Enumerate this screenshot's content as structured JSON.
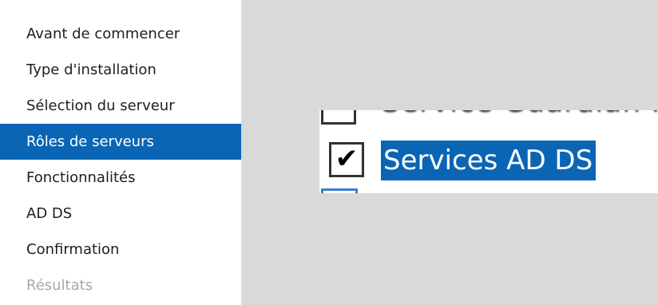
{
  "wizard_nav": {
    "items": [
      {
        "label": "Avant de commencer"
      },
      {
        "label": "Type d'installation"
      },
      {
        "label": "Sélection du serveur"
      },
      {
        "label": "Rôles de serveurs"
      },
      {
        "label": "Fonctionnalités"
      },
      {
        "label": "AD DS"
      },
      {
        "label": "Confirmation"
      },
      {
        "label": "Résultats"
      }
    ],
    "selected": "Rôles de serveurs"
  },
  "roles_zoom": {
    "row_above_label": "Service Guardian Hôte",
    "selected_role": {
      "checkbox_glyph": "✔",
      "label": "Services AD DS",
      "checked": true
    }
  },
  "colors": {
    "selection_blue": "#0a66b4",
    "background_gray": "#d9d9d9",
    "sidebar_white": "#ffffff"
  }
}
